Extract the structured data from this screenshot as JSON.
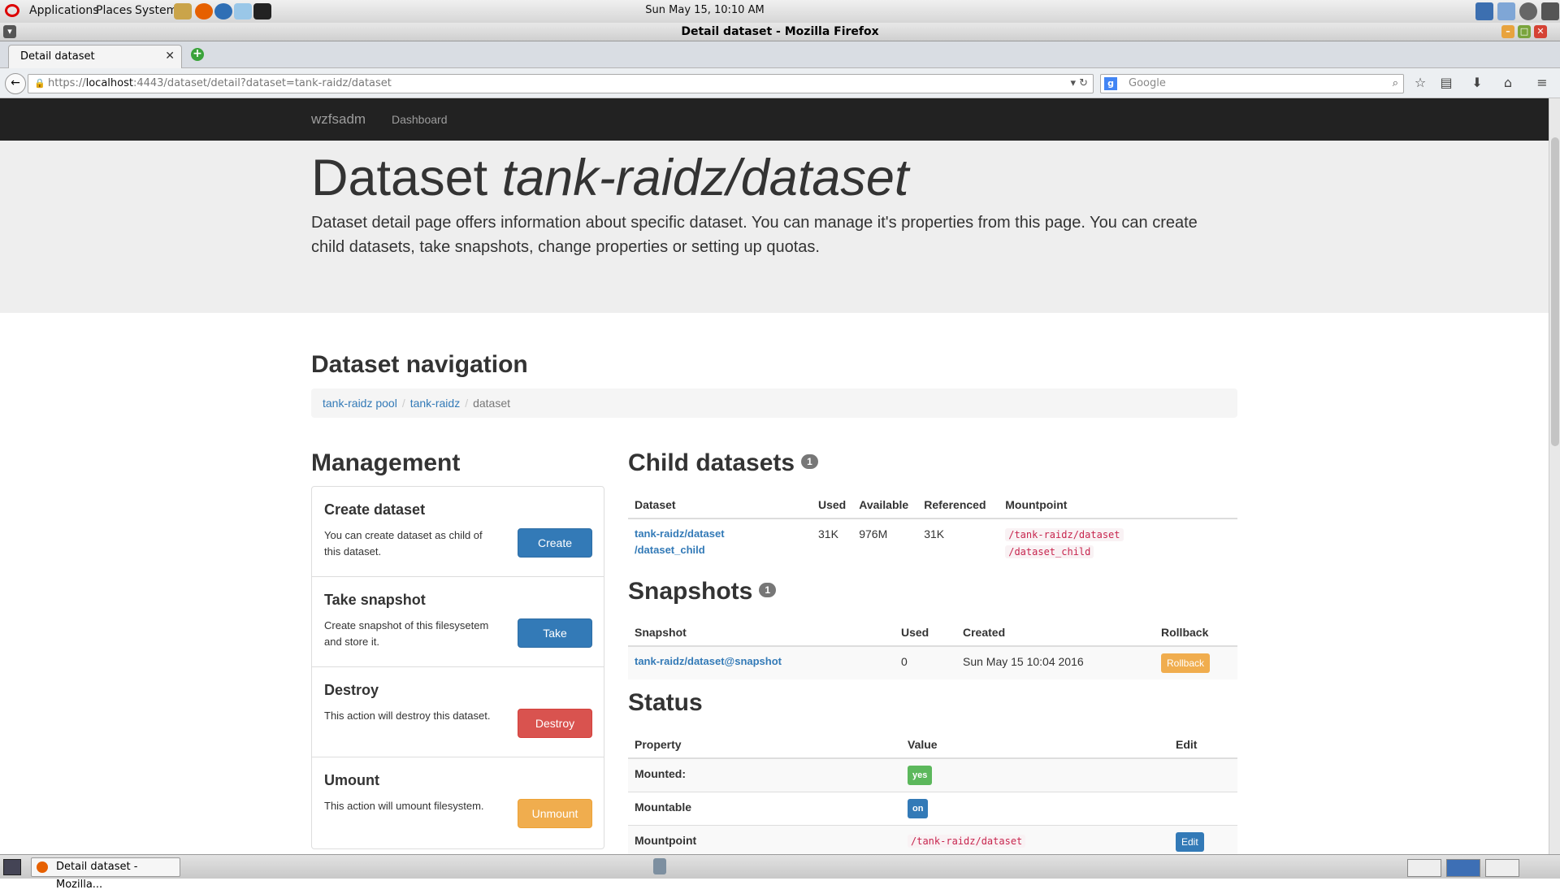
{
  "os": {
    "menus": [
      "Applications",
      "Places",
      "System"
    ],
    "clock": "Sun May 15, 10:10 AM",
    "window_title": "Detail dataset - Mozilla Firefox",
    "taskbar_item": "Detail dataset - Mozilla..."
  },
  "browser": {
    "tab_title": "Detail dataset",
    "url_prefix": "https://",
    "url_host": "localhost",
    "url_rest": ":4443/dataset/detail?dataset=tank-raidz/dataset",
    "search_placeholder": "Google"
  },
  "site": {
    "brand": "wzfsadm",
    "nav_dashboard": "Dashboard"
  },
  "jumbotron": {
    "title_plain": "Dataset ",
    "title_italic": "tank-raidz/dataset",
    "description": "Dataset detail page offers information about specific dataset. You can manage it's properties from this page. You can create child datasets, take snapshots, change properties or setting up quotas."
  },
  "navigation": {
    "heading": "Dataset navigation",
    "crumbs": [
      "tank-raidz pool",
      "tank-raidz",
      "dataset"
    ]
  },
  "management": {
    "heading": "Management",
    "items": [
      {
        "title": "Create dataset",
        "text": "You can create dataset as child of this dataset.",
        "button": "Create"
      },
      {
        "title": "Take snapshot",
        "text": "Create snapshot of this filesysetem and store it.",
        "button": "Take"
      },
      {
        "title": "Destroy",
        "text": "This action will destroy this dataset.",
        "button": "Destroy"
      },
      {
        "title": "Umount",
        "text": "This action will umount filesystem.",
        "button": "Unmount"
      }
    ]
  },
  "child_datasets": {
    "heading": "Child datasets",
    "count": "1",
    "columns": [
      "Dataset",
      "Used",
      "Available",
      "Referenced",
      "Mountpoint"
    ],
    "rows": [
      {
        "dataset_l1": "tank-raidz/dataset",
        "dataset_l2": "/dataset_child",
        "used": "31K",
        "available": "976M",
        "referenced": "31K",
        "mount_l1": "/tank-raidz/dataset",
        "mount_l2": "/dataset_child"
      }
    ]
  },
  "snapshots": {
    "heading": "Snapshots",
    "count": "1",
    "columns": [
      "Snapshot",
      "Used",
      "Created",
      "Rollback"
    ],
    "rows": [
      {
        "name": "tank-raidz/dataset@snapshot",
        "used": "0",
        "created": "Sun May 15 10:04 2016",
        "rollback": "Rollback"
      }
    ]
  },
  "status": {
    "heading": "Status",
    "columns": [
      "Property",
      "Value",
      "Edit"
    ],
    "rows": [
      {
        "property": "Mounted:",
        "value": "yes"
      },
      {
        "property": "Mountable",
        "value": "on"
      },
      {
        "property": "Mountpoint",
        "value": "/tank-raidz/dataset",
        "edit": "Edit"
      }
    ]
  },
  "colors": {
    "primary": "#337ab7",
    "danger": "#d9534f",
    "warning": "#f0ad4e",
    "success": "#5cb85c",
    "navbar": "#222222"
  }
}
